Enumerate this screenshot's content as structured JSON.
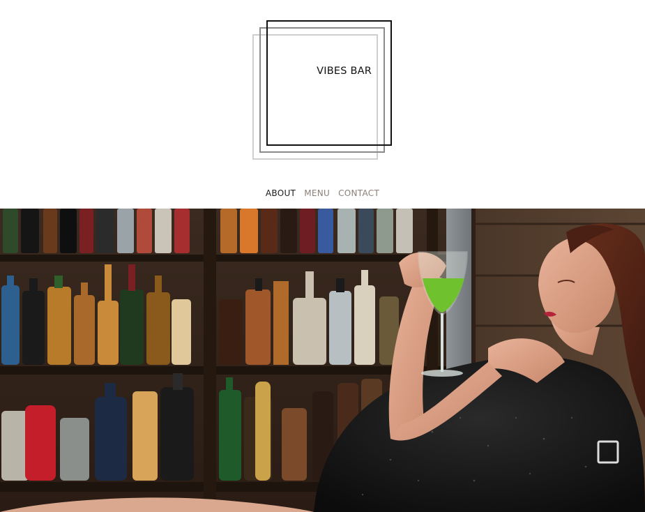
{
  "logo": {
    "text": "VIBES BAR"
  },
  "nav": {
    "items": [
      {
        "label": "ABOUT",
        "active": true
      },
      {
        "label": "MENU",
        "active": false
      },
      {
        "label": "CONTACT",
        "active": false
      }
    ]
  },
  "hero": {
    "image": "bar-woman-photo-icon"
  },
  "colors": {
    "nav_active": "#1a1a1a",
    "nav_inactive": "#8a7f78",
    "logo_dark": "#111111",
    "logo_mid": "#8a8a8a",
    "logo_light": "#cfcfcf"
  }
}
